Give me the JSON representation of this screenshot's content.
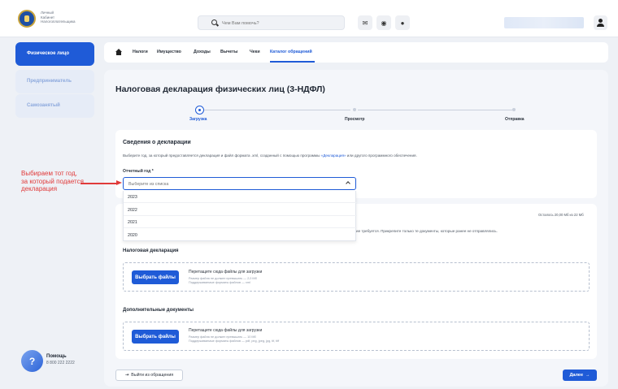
{
  "header": {
    "logo_text": [
      "Личный",
      "Кабинет",
      "Налогоплательщика"
    ],
    "search_placeholder": "Чем Вам помочь?"
  },
  "sidebar": {
    "items": [
      {
        "label": "Физическое лицо",
        "active": true
      },
      {
        "label": "Предприниматель",
        "active": false
      },
      {
        "label": "Самозанятый",
        "active": false
      }
    ],
    "help": {
      "icon": "?",
      "title": "Помощь",
      "phone": "8 800 222 2222"
    }
  },
  "nav": {
    "items": [
      "Налоги",
      "Имущество",
      "Доходы",
      "Вычеты",
      "Чеки",
      "Каталог обращений"
    ],
    "active_index": 5
  },
  "page": {
    "title": "Налоговая декларация физических лиц (3-НДФЛ)"
  },
  "steps": [
    {
      "label": "Загрузка",
      "active": true
    },
    {
      "label": "Просмотр",
      "active": false
    },
    {
      "label": "Отправка",
      "active": false
    }
  ],
  "declaration_info": {
    "title": "Сведения о декларации",
    "description_before": "Выберите год, за который предоставляется декларация и файл формата .xml, созданный с помощью программы ",
    "description_link": "«Декларация»",
    "description_after": " или другого программного обеспечения.",
    "year_label": "Отчетный год *",
    "year_placeholder": "Выберите из списка",
    "year_options": [
      "2023",
      "2022",
      "2021",
      "2020"
    ]
  },
  "annotation": {
    "lines": [
      "Выбираем тот год,",
      "за который подается",
      "декларация"
    ],
    "color": "#e03a3a"
  },
  "files": {
    "remaining": "Осталось 20,00 Мб из 22 Мб",
    "note_fragment": "ие требуется. Прикрепите только те документы, которые ранее не отправлялись.",
    "declaration": {
      "title": "Налоговая декларация",
      "button": "Выбрать файлы",
      "drop_text": "Перетащите сюда файлы для загрузки",
      "hint1": "Размер файла не должен превышать — 2,0 Мб",
      "hint2": "Поддерживаемые форматы файлов — xml"
    },
    "additional": {
      "title": "Дополнительные документы",
      "button": "Выбрать файлы",
      "drop_text": "Перетащите сюда файлы для загрузки",
      "hint1": "Размер файла не должен превышать — 10 Мб",
      "hint2": "Поддерживаемые форматы файлов — pdf, png, jpeg, jpg, tif, tiff"
    }
  },
  "footer": {
    "exit_icon": "⇥",
    "exit_label": "Выйти из обращения",
    "next_label": "Далее",
    "next_icon": "→"
  },
  "colors": {
    "accent": "#1f5bd7",
    "annotation": "#e03a3a"
  }
}
